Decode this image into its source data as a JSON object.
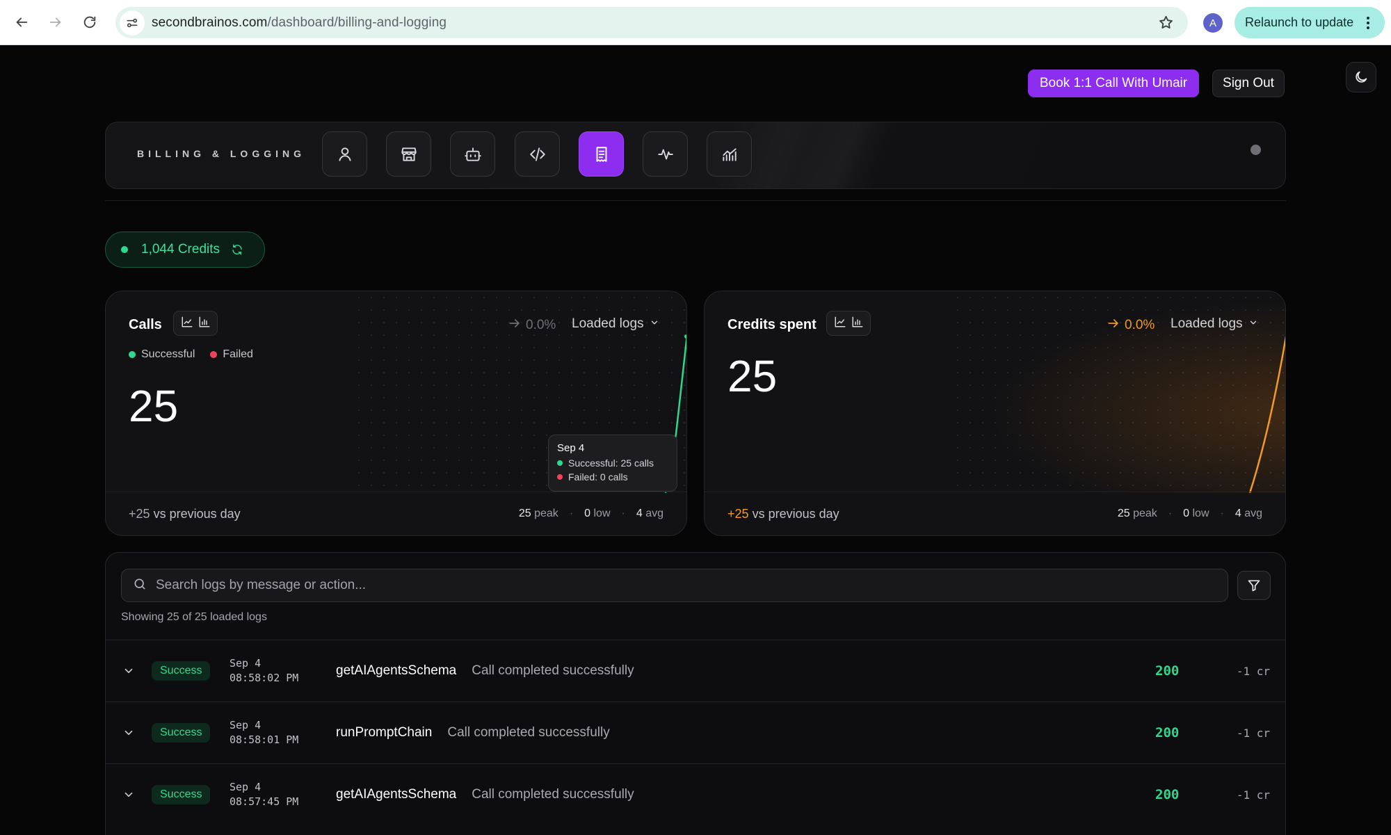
{
  "browser": {
    "url_host": "secondbrainos.com",
    "url_path": "/dashboard/billing-and-logging",
    "profile_initial": "A",
    "relaunch_label": "Relaunch to update"
  },
  "header": {
    "book_call_label": "Book 1:1 Call With Umair",
    "sign_out_label": "Sign Out"
  },
  "toolbar": {
    "title": "BILLING & LOGGING",
    "icons": [
      "user-icon",
      "store-icon",
      "bot-icon",
      "code-icon",
      "receipt-icon",
      "activity-icon",
      "analytics-icon"
    ],
    "active_index": 4
  },
  "credits": {
    "label": "1,044 Credits"
  },
  "calls_card": {
    "title": "Calls",
    "trend": "0.0%",
    "range_label": "Loaded logs",
    "legend": [
      {
        "label": "Successful",
        "color": "#2fd88f"
      },
      {
        "label": "Failed",
        "color": "#f0445a"
      }
    ],
    "value": "25",
    "delta": "+25",
    "delta_suffix": "vs previous day",
    "peak": "25",
    "peak_label": "peak",
    "low": "0",
    "low_label": "low",
    "avg": "4",
    "avg_label": "avg",
    "tooltip": {
      "date": "Sep 4",
      "successful": "Successful: 25 calls",
      "failed": "Failed: 0 calls"
    }
  },
  "credits_card": {
    "title": "Credits spent",
    "trend": "0.0%",
    "range_label": "Loaded logs",
    "value": "25",
    "delta": "+25",
    "delta_suffix": "vs previous day",
    "peak": "25",
    "peak_label": "peak",
    "low": "0",
    "low_label": "low",
    "avg": "4",
    "avg_label": "avg",
    "accent": "#f29a25"
  },
  "logs": {
    "search_placeholder": "Search logs by message or action...",
    "showing": "Showing 25 of 25 loaded logs",
    "rows": [
      {
        "status": "Success",
        "date": "Sep 4",
        "time": "08:58:02 PM",
        "action": "getAIAgentsSchema",
        "message": "Call completed successfully",
        "code": "200",
        "cost": "-1 cr"
      },
      {
        "status": "Success",
        "date": "Sep 4",
        "time": "08:58:01 PM",
        "action": "runPromptChain",
        "message": "Call completed successfully",
        "code": "200",
        "cost": "-1 cr"
      },
      {
        "status": "Success",
        "date": "Sep 4",
        "time": "08:57:45 PM",
        "action": "getAIAgentsSchema",
        "message": "Call completed successfully",
        "code": "200",
        "cost": "-1 cr"
      }
    ]
  }
}
